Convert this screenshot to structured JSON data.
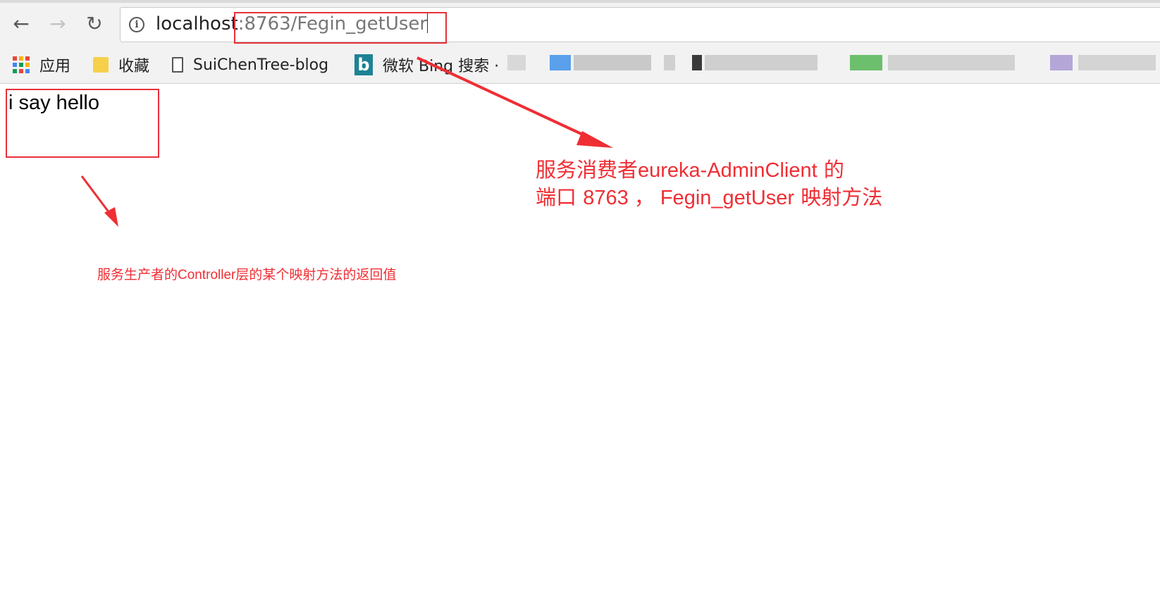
{
  "browser": {
    "back_icon": "←",
    "forward_icon": "→",
    "reload_icon": "↻",
    "info_icon": "i",
    "url_host": "localhost",
    "url_path": ":8763/Fegin_getUser"
  },
  "bookmarks": [
    {
      "label": "应用",
      "icon": "apps-grid-icon"
    },
    {
      "label": "收藏",
      "icon": "folder-icon"
    },
    {
      "label": "SuiChenTree-blog",
      "icon": "page-icon"
    },
    {
      "label": "微软 Bing 搜索 ·",
      "icon": "bing-icon"
    }
  ],
  "bing_glyph": "b",
  "page": {
    "response_text": "i say hello"
  },
  "annotations": {
    "consumer_line1_cn": "服务消费者",
    "consumer_line1_name": "eureka-AdminClient",
    "consumer_line1_cn2": " 的",
    "consumer_line2_cn": "端口 ",
    "consumer_line2_mid": "8763 ， Fegin_getUser",
    "consumer_line2_cn2": " 映射方法",
    "producer_cn1": "服务生产者的",
    "producer_name": "Controller",
    "producer_cn2": "层的某个映射方法的返回值"
  },
  "colors": {
    "annotation_red": "#ef2e34",
    "chrome_bg": "#f2f2f2"
  }
}
